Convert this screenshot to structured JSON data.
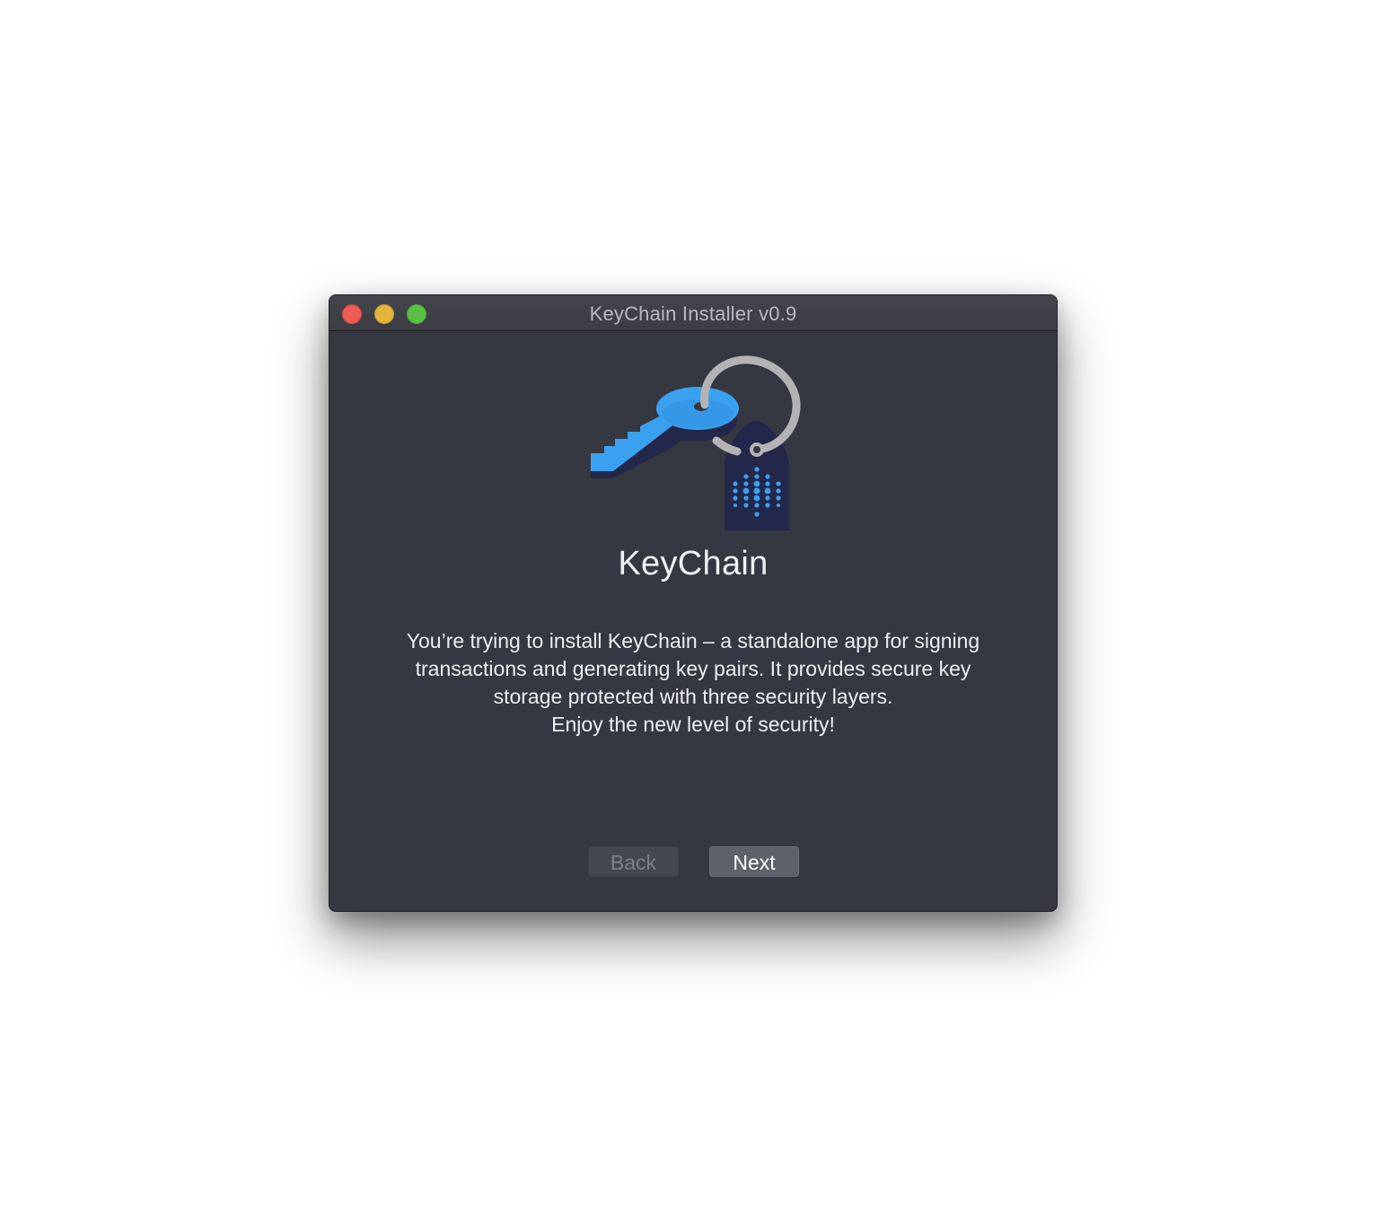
{
  "window": {
    "title": "KeyChain Installer v0.9"
  },
  "traffic_lights": {
    "close_color": "#ee5b53",
    "minimize_color": "#e3b43e",
    "zoom_color": "#5bbf45"
  },
  "app": {
    "icon": "keychain-key-tag-icon",
    "name": "KeyChain"
  },
  "description": {
    "lines": [
      "You’re trying to install KeyChain – a standalone app for signing",
      "transactions and generating key pairs. It provides secure key",
      "storage protected with three security layers.",
      "Enjoy the new level of security!"
    ]
  },
  "buttons": {
    "back_label": "Back",
    "next_label": "Next",
    "back_enabled": false,
    "next_enabled": true
  },
  "colors": {
    "window_bg": "#353741",
    "key_blue": "#3aa0f0",
    "tag_navy": "#23274a",
    "ring_gray": "#b3b3b5"
  }
}
